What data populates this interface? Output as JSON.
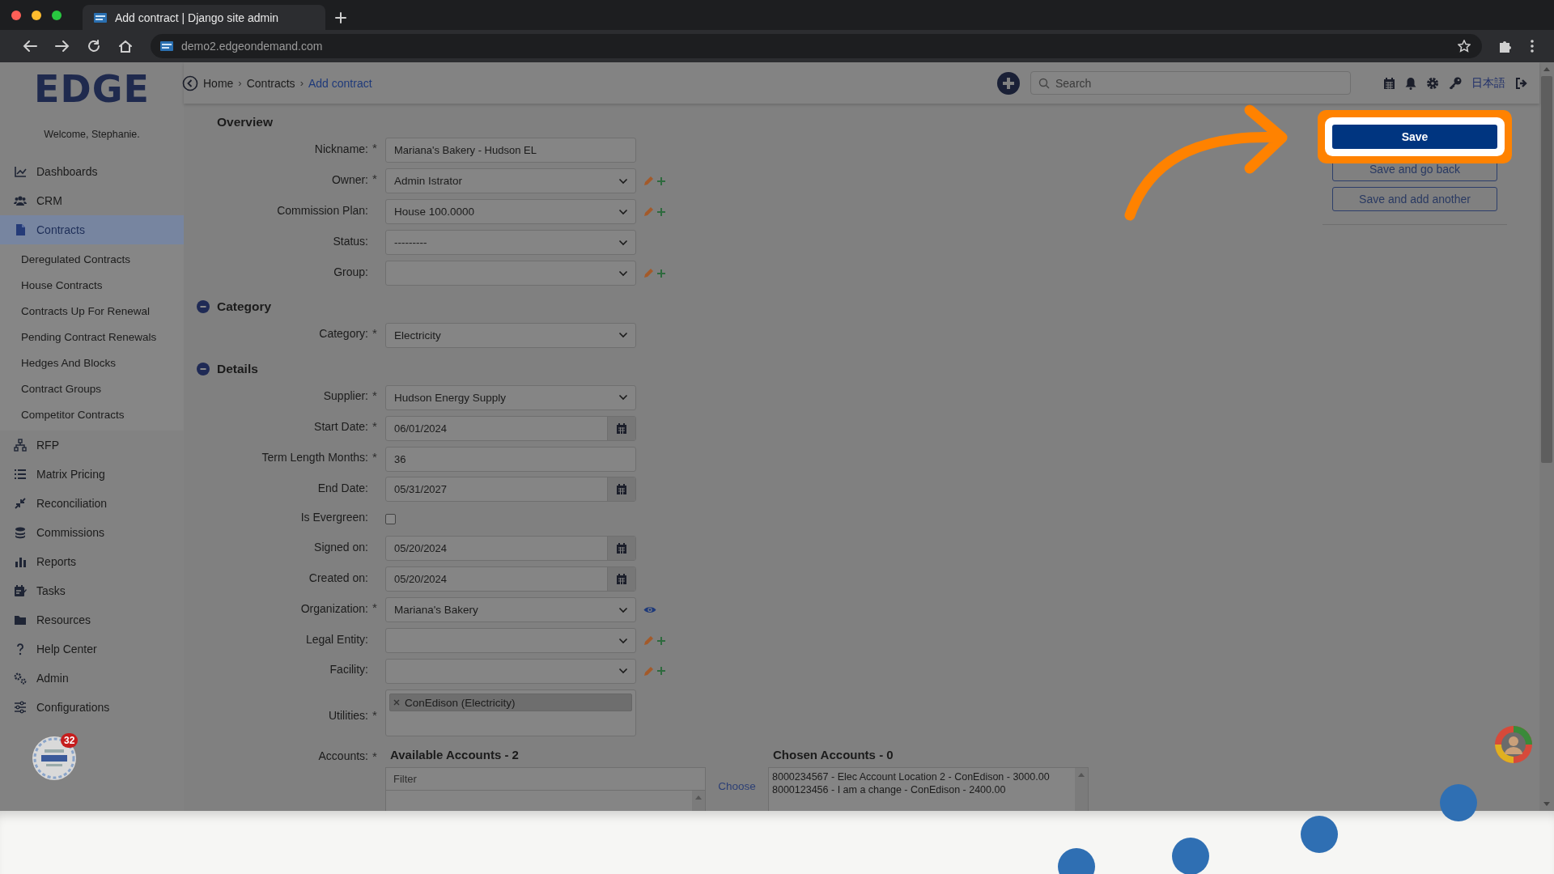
{
  "browser": {
    "tab_title": "Add contract | Django site admin",
    "url": "demo2.edgeondemand.com"
  },
  "sidebar": {
    "logo": "EDGE",
    "welcome": "Welcome, Stephanie.",
    "items": [
      {
        "label": "Dashboards",
        "selected": false
      },
      {
        "label": "CRM",
        "selected": false
      },
      {
        "label": "Contracts",
        "selected": true,
        "expanded": true,
        "children": [
          {
            "label": "Deregulated Contracts",
            "selected": false
          },
          {
            "label": "House Contracts",
            "selected": false
          },
          {
            "label": "Contracts Up For Renewal",
            "selected": false
          },
          {
            "label": "Pending Contract Renewals",
            "selected": false
          },
          {
            "label": "Hedges And Blocks",
            "selected": false
          },
          {
            "label": "Contract Groups",
            "selected": false
          },
          {
            "label": "Competitor Contracts",
            "selected": false
          }
        ]
      },
      {
        "label": "RFP",
        "selected": false
      },
      {
        "label": "Matrix Pricing",
        "selected": false
      },
      {
        "label": "Reconciliation",
        "selected": false
      },
      {
        "label": "Commissions",
        "selected": false
      },
      {
        "label": "Reports",
        "selected": false
      },
      {
        "label": "Tasks",
        "selected": false
      },
      {
        "label": "Resources",
        "selected": false
      },
      {
        "label": "Help Center",
        "selected": false
      },
      {
        "label": "Admin",
        "selected": false
      },
      {
        "label": "Configurations",
        "selected": false
      }
    ],
    "notification_count": "32"
  },
  "topbar": {
    "breadcrumbs": [
      {
        "label": "Home",
        "current": false
      },
      {
        "label": "Contracts",
        "current": false
      },
      {
        "label": "Add contract",
        "current": true
      }
    ],
    "separator": "›",
    "search": {
      "placeholder": "Search"
    },
    "language": "日本語"
  },
  "form": {
    "required_mark": "*",
    "sections": [
      {
        "title": "Overview",
        "collapsible": false,
        "fields": [
          {
            "label": "Nickname:",
            "kind": "text",
            "required": true,
            "value": "Mariana's Bakery - Hudson EL"
          },
          {
            "label": "Owner:",
            "kind": "select",
            "required": true,
            "value": "Admin Istrator",
            "editable": true,
            "addable": true
          },
          {
            "label": "Commission Plan:",
            "kind": "select",
            "required": false,
            "value": "House 100.0000",
            "editable": true,
            "addable": true
          },
          {
            "label": "Status:",
            "kind": "select",
            "required": false,
            "value": "---------"
          },
          {
            "label": "Group:",
            "kind": "select",
            "required": false,
            "editable": true,
            "addable": true
          }
        ]
      },
      {
        "title": "Category",
        "collapsible": true,
        "fields": [
          {
            "label": "Category:",
            "kind": "select",
            "required": true,
            "value": "Electricity"
          }
        ]
      },
      {
        "title": "Details",
        "collapsible": true,
        "fields": [
          {
            "label": "Supplier:",
            "kind": "select",
            "required": true,
            "value": "Hudson Energy Supply"
          },
          {
            "label": "Start Date:",
            "kind": "date",
            "required": true,
            "value": "06/01/2024"
          },
          {
            "label": "Term Length Months:",
            "kind": "text",
            "required": true,
            "value": "36"
          },
          {
            "label": "End Date:",
            "kind": "date",
            "required": false,
            "value": "05/31/2027"
          },
          {
            "label": "Is Evergreen:",
            "kind": "checkbox",
            "required": false,
            "checked": false
          },
          {
            "label": "Signed on:",
            "kind": "date",
            "required": false,
            "value": "05/20/2024"
          },
          {
            "label": "Created on:",
            "kind": "date",
            "required": false,
            "value": "05/20/2024"
          },
          {
            "label": "Organization:",
            "kind": "select",
            "required": true,
            "value": "Mariana's Bakery",
            "viewable": true
          },
          {
            "label": "Legal Entity:",
            "kind": "select",
            "required": false,
            "editable": true,
            "addable": true
          },
          {
            "label": "Facility:",
            "kind": "select",
            "required": false,
            "editable": true,
            "addable": true
          },
          {
            "label": "Utilities:",
            "kind": "tags",
            "required": true,
            "tags": [
              "ConEdison (Electricity)"
            ]
          },
          {
            "label": "Accounts:",
            "kind": "accounts",
            "required": true,
            "available_title": "Available Accounts - 2",
            "filter_placeholder": "Filter",
            "choose": "Choose",
            "chosen_title": "Chosen Accounts - 0",
            "chosen": [
              "8000234567 - Elec Account Location 2 - ConEdison - 3000.00",
              "8000123456 - I am a change - ConEdison - 2400.00"
            ]
          }
        ]
      }
    ]
  },
  "actions": [
    {
      "label": "Save",
      "kind": "primary",
      "highlighted": true
    },
    {
      "label": "Save and go back",
      "kind": "secondary",
      "highlighted": false
    },
    {
      "label": "Save and add another",
      "kind": "secondary",
      "highlighted": false
    }
  ]
}
